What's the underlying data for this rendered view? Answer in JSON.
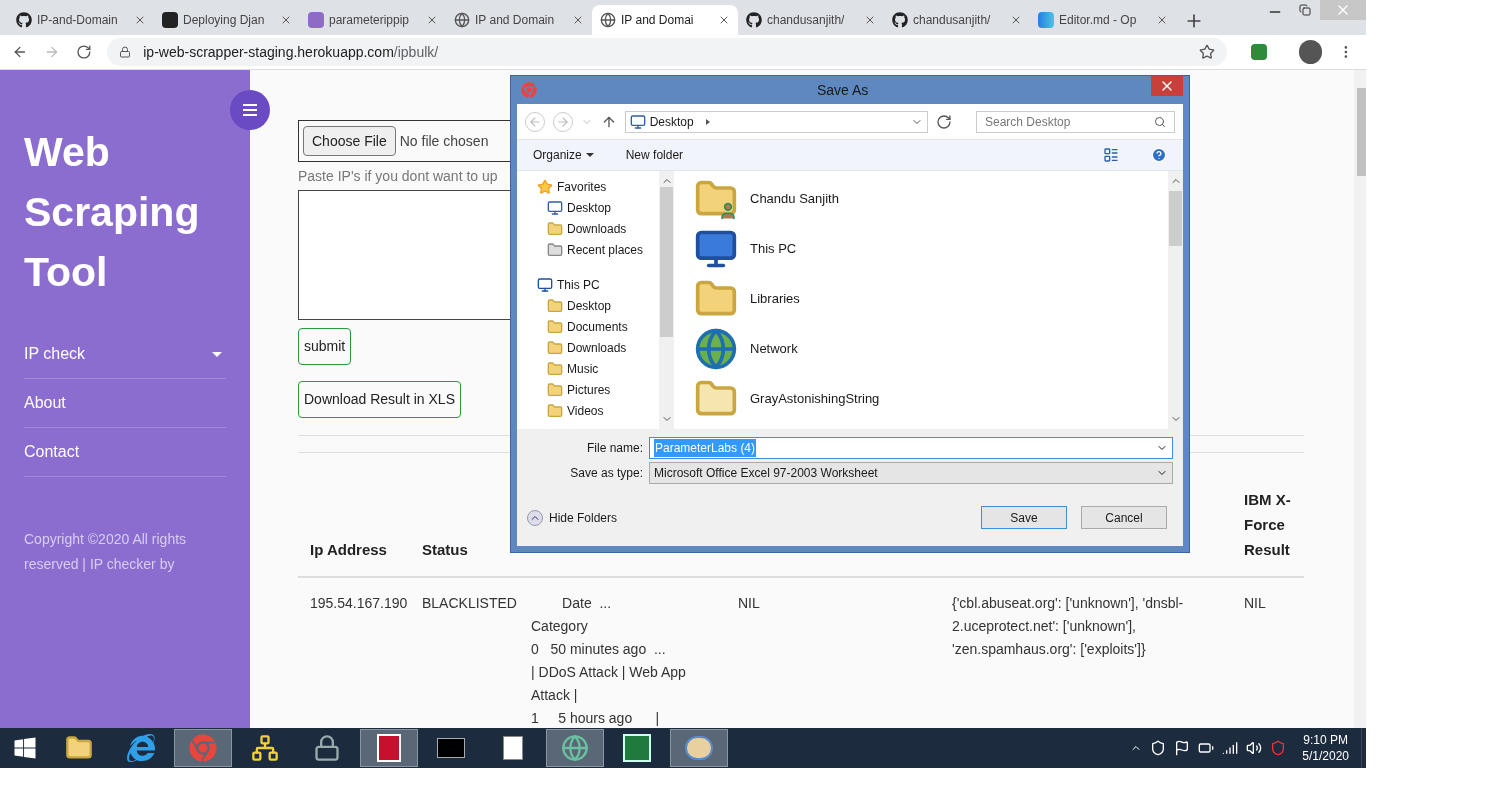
{
  "browser": {
    "tabs": [
      {
        "kind": "github",
        "title": "IP-and-Domain",
        "selected": false
      },
      {
        "kind": "sa",
        "title": "Deploying Djan",
        "selected": false
      },
      {
        "kind": "heroku",
        "title": "parameterippip",
        "selected": false
      },
      {
        "kind": "globe",
        "title": "IP and Domain",
        "selected": false
      },
      {
        "kind": "globe",
        "title": "IP and Domai",
        "selected": true
      },
      {
        "kind": "github",
        "title": "chandusanjith/",
        "selected": false
      },
      {
        "kind": "github",
        "title": "chandusanjith/",
        "selected": false
      },
      {
        "kind": "editor",
        "title": "Editor.md - Op",
        "selected": false
      }
    ],
    "url": {
      "host": "ip-web-scrapper-staging.herokuapp.com",
      "path": "/ipbulk/"
    }
  },
  "sidebar": {
    "title": "Web Scraping Tool",
    "items": [
      {
        "label": "IP check",
        "expandable": true
      },
      {
        "label": "About",
        "expandable": false
      },
      {
        "label": "Contact",
        "expandable": false
      }
    ],
    "copyright": "Copyright ©2020 All rights reserved | IP checker by"
  },
  "form": {
    "choose_file": "Choose File",
    "file_status": "No file chosen",
    "paste_hint": "Paste IP's if you dont want to up",
    "submit": "submit",
    "download": "Download Result in XLS"
  },
  "table": {
    "columns": [
      {
        "label": "Ip Address"
      },
      {
        "label": "Status"
      },
      {
        "label": "IBM X-Force Result"
      }
    ],
    "rows": [
      {
        "ip": "195.54.167.190",
        "status": "BLACKLISTED",
        "column_3": [
          "        Date  ...",
          "Category",
          "0   50 minutes ago  ...",
          "| DDoS Attack | Web App",
          "Attack |",
          "1     5 hours ago      |"
        ],
        "column_4": "NIL",
        "column_5": "{'cbl.abuseat.org': ['unknown'], 'dnsbl-2.uceprotect.net': ['unknown'], 'zen.spamhaus.org': ['exploits']}",
        "ibm": "NIL"
      }
    ]
  },
  "dialog": {
    "title": "Save As",
    "location": "Desktop",
    "search_placeholder": "Search Desktop",
    "toolbar": [
      "Organize",
      "New folder"
    ],
    "tree": [
      {
        "label": "Favorites",
        "kind": "star",
        "children": [
          {
            "label": "Desktop",
            "kind": "desktop"
          },
          {
            "label": "Downloads",
            "kind": "downloads"
          },
          {
            "label": "Recent places",
            "kind": "recent"
          }
        ]
      },
      {
        "label": "This PC",
        "kind": "pc",
        "children": [
          {
            "label": "Desktop",
            "kind": "folder"
          },
          {
            "label": "Documents",
            "kind": "folder"
          },
          {
            "label": "Downloads",
            "kind": "downloads"
          },
          {
            "label": "Music",
            "kind": "folder"
          },
          {
            "label": "Pictures",
            "kind": "folder"
          },
          {
            "label": "Videos",
            "kind": "folder"
          }
        ]
      }
    ],
    "items": [
      {
        "label": "Chandu Sanjith",
        "kind": "user"
      },
      {
        "label": "This PC",
        "kind": "pc"
      },
      {
        "label": "Libraries",
        "kind": "libraries"
      },
      {
        "label": "Network",
        "kind": "network"
      },
      {
        "label": "GrayAstonishingString",
        "kind": "folder"
      }
    ],
    "file_name_label": "File name:",
    "file_name": "ParameterLabs (4)",
    "type_label": "Save as type:",
    "type": "Microsoft Office Excel 97-2003 Worksheet",
    "hide_folders": "Hide Folders",
    "save": "Save",
    "cancel": "Cancel"
  },
  "taskbar": {
    "apps": [
      {
        "kind": "explorer",
        "active": false
      },
      {
        "kind": "ie",
        "active": false
      },
      {
        "kind": "chrome",
        "active": true
      },
      {
        "kind": "network",
        "active": false
      },
      {
        "kind": "lock",
        "active": false
      },
      {
        "kind": "notepad",
        "active": true
      },
      {
        "kind": "cmd",
        "active": false
      },
      {
        "kind": "files",
        "active": false
      },
      {
        "kind": "globe",
        "active": true
      },
      {
        "kind": "excel",
        "active": false
      },
      {
        "kind": "paint",
        "active": true
      }
    ],
    "time": "9:10 PM",
    "date": "5/1/2020"
  }
}
